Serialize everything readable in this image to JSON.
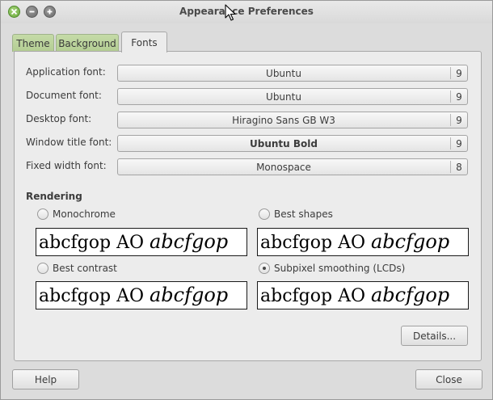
{
  "window": {
    "title": "Appearance Preferences"
  },
  "tabs": [
    {
      "label": "Theme"
    },
    {
      "label": "Background"
    },
    {
      "label": "Fonts"
    }
  ],
  "fonts": [
    {
      "label": "Application font:",
      "name": "Ubuntu",
      "size": "9"
    },
    {
      "label": "Document font:",
      "name": "Ubuntu",
      "size": "9"
    },
    {
      "label": "Desktop font:",
      "name": "Hiragino Sans GB W3",
      "size": "9"
    },
    {
      "label": "Window title font:",
      "name": "Ubuntu Bold",
      "size": "9"
    },
    {
      "label": "Fixed width font:",
      "name": "Monospace",
      "size": "8"
    }
  ],
  "rendering": {
    "heading": "Rendering",
    "options": [
      {
        "label": "Monochrome",
        "checked": false
      },
      {
        "label": "Best shapes",
        "checked": false
      },
      {
        "label": "Best contrast",
        "checked": false
      },
      {
        "label": "Subpixel smoothing (LCDs)",
        "checked": true
      }
    ],
    "preview_plain": "abcfgop AO ",
    "preview_italic": "abcfgop"
  },
  "buttons": {
    "details": "Details...",
    "help": "Help",
    "close": "Close"
  },
  "colors": {
    "tab_inactive": "#c5dba8",
    "close_button": "#6aa83c"
  }
}
